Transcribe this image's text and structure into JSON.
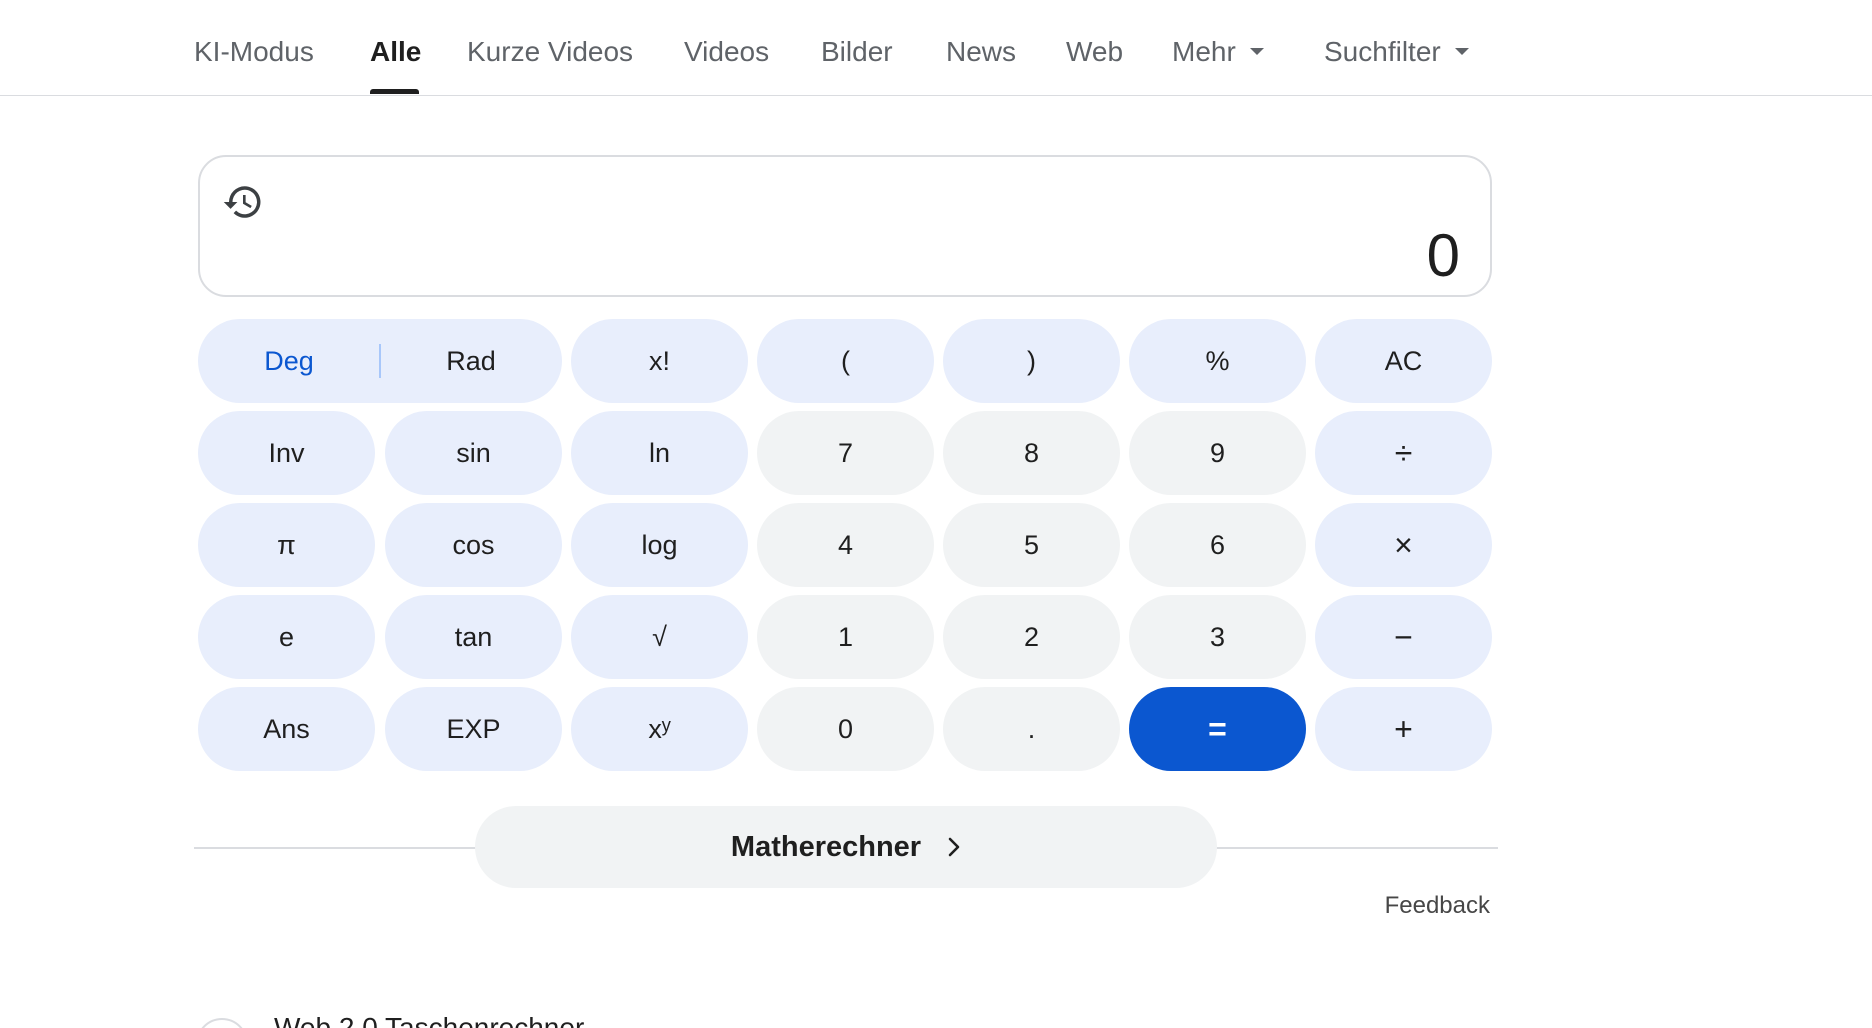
{
  "nav": {
    "items": [
      {
        "label": "KI-Modus"
      },
      {
        "label": "Alle",
        "active": true
      },
      {
        "label": "Kurze Videos"
      },
      {
        "label": "Videos"
      },
      {
        "label": "Bilder"
      },
      {
        "label": "News"
      },
      {
        "label": "Web"
      },
      {
        "label": "Mehr",
        "dropdown": true
      },
      {
        "label": "Suchfilter",
        "dropdown": true
      }
    ]
  },
  "calculator": {
    "display": "0",
    "history_icon": "history-icon",
    "angle_mode": {
      "deg": "Deg",
      "rad": "Rad",
      "selected": "Deg"
    },
    "rows": [
      [
        "x!",
        "(",
        ")",
        "%",
        "AC"
      ],
      [
        "Inv",
        "sin",
        "ln",
        "7",
        "8",
        "9",
        "÷"
      ],
      [
        "π",
        "cos",
        "log",
        "4",
        "5",
        "6",
        "×"
      ],
      [
        "e",
        "tan",
        "√",
        "1",
        "2",
        "3",
        "−"
      ],
      [
        "Ans",
        "EXP",
        "xʸ",
        "0",
        ".",
        "=",
        "+"
      ]
    ],
    "colors": {
      "function": "#e8eefc",
      "number": "#f1f3f4",
      "equals": "#0b57d0"
    }
  },
  "math_solver": {
    "label": "Matherechner",
    "icon": "chevron-right-icon"
  },
  "feedback": {
    "label": "Feedback"
  },
  "next_result": {
    "title": "Web 2.0 Taschenrechner"
  }
}
